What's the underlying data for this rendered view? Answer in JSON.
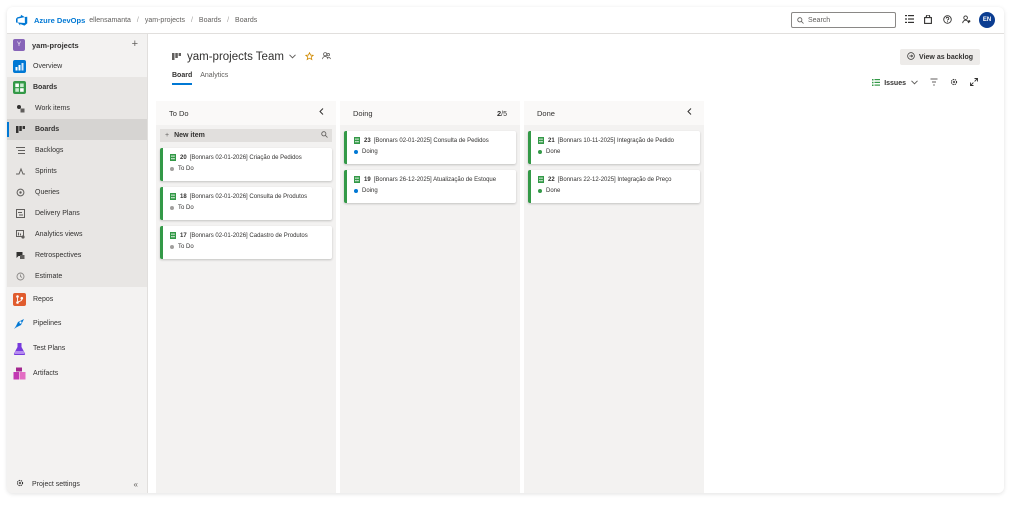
{
  "topbar": {
    "brand": "Azure DevOps",
    "breadcrumbs": [
      "ellensamanta",
      "yam-projects",
      "Boards",
      "Boards"
    ],
    "separator": "/",
    "search_placeholder": "Search",
    "avatar_initials": "EN"
  },
  "sidebar": {
    "project_initial": "Y",
    "project_name": "yam-projects",
    "items": [
      {
        "label": "Overview"
      },
      {
        "label": "Boards"
      },
      {
        "label": "Work items"
      },
      {
        "label": "Boards"
      },
      {
        "label": "Backlogs"
      },
      {
        "label": "Sprints"
      },
      {
        "label": "Queries"
      },
      {
        "label": "Delivery Plans"
      },
      {
        "label": "Analytics views"
      },
      {
        "label": "Retrospectives"
      },
      {
        "label": "Estimate"
      },
      {
        "label": "Repos"
      },
      {
        "label": "Pipelines"
      },
      {
        "label": "Test Plans"
      },
      {
        "label": "Artifacts"
      }
    ],
    "footer": "Project settings"
  },
  "header": {
    "team_name": "yam-projects Team",
    "tabs": [
      {
        "label": "Board"
      },
      {
        "label": "Analytics"
      }
    ],
    "view_backlog": "View as backlog",
    "filter_label": "Issues"
  },
  "board": {
    "columns": [
      {
        "title": "To Do",
        "new_item": "New item",
        "cards": [
          {
            "id": "20",
            "title": "[Bonnars 02-01-2026] Criação de Pedidos",
            "state": "To Do"
          },
          {
            "id": "18",
            "title": "[Bonnars 02-01-2026] Consulta de Produtos",
            "state": "To Do"
          },
          {
            "id": "17",
            "title": "[Bonnars 02-01-2026] Cadastro de Produtos",
            "state": "To Do"
          }
        ]
      },
      {
        "title": "Doing",
        "count": "2",
        "limit": "/5",
        "cards": [
          {
            "id": "23",
            "title": "[Bonnars 02-01-2025] Consulta de Pedidos",
            "state": "Doing"
          },
          {
            "id": "19",
            "title": "[Bonnars 26-12-2025] Atualização de Estoque",
            "state": "Doing"
          }
        ]
      },
      {
        "title": "Done",
        "cards": [
          {
            "id": "21",
            "title": "[Bonnars 10-11-2025] Integração de Pedido",
            "state": "Done"
          },
          {
            "id": "22",
            "title": "[Bonnars 22-12-2025] Integração de Preço",
            "state": "Done"
          }
        ]
      }
    ]
  },
  "colors": {
    "accent": "#0078d4",
    "card_border": "#339947",
    "todo_dot": "#a19f9d",
    "doing_dot": "#0078d4",
    "done_dot": "#339947"
  }
}
